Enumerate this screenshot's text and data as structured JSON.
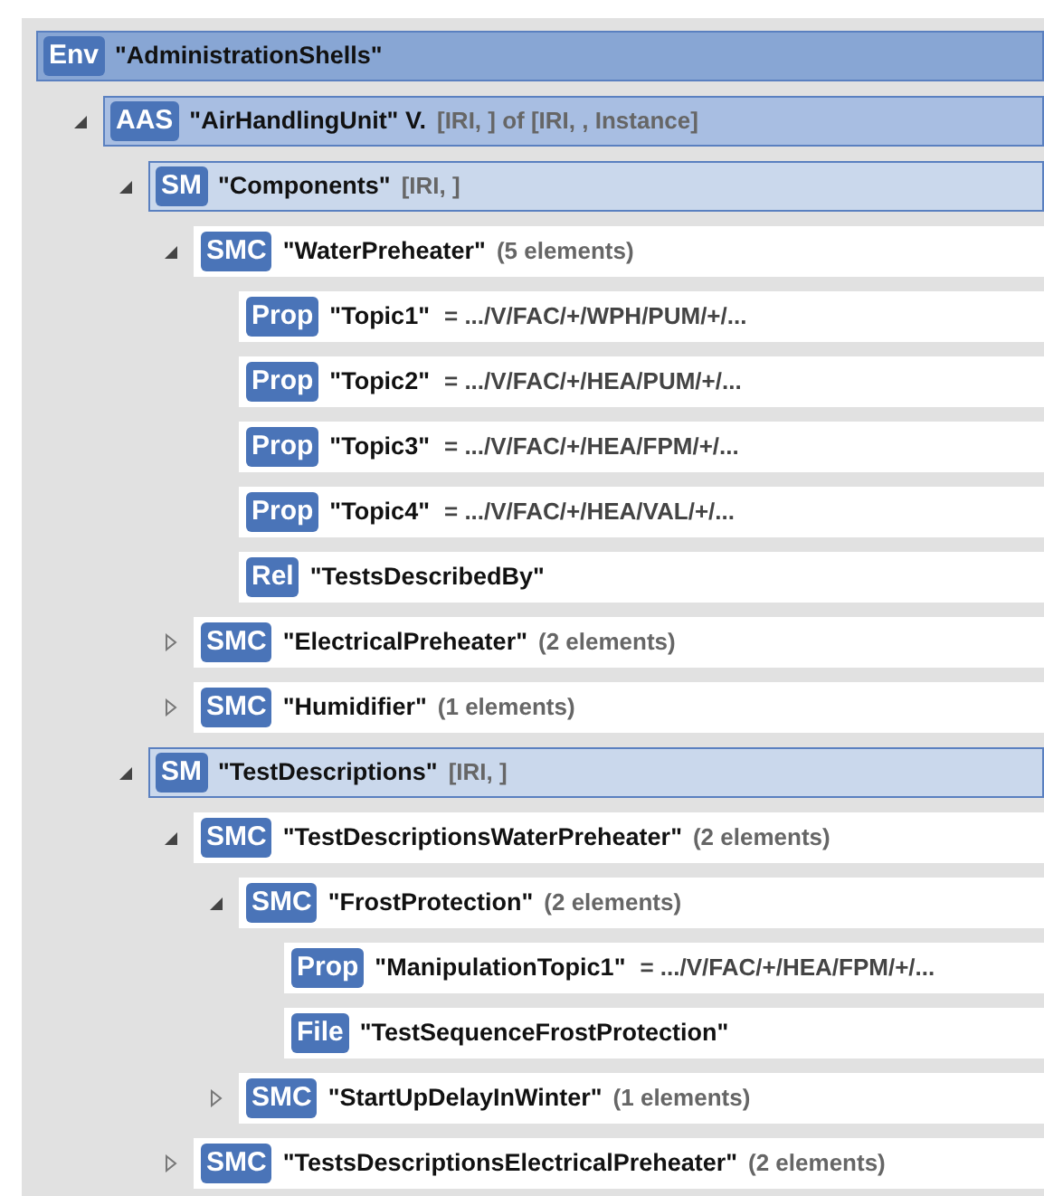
{
  "tree": [
    {
      "kind": "env",
      "tag": "Env",
      "name": "\"AdministrationShells\"",
      "children": [
        {
          "kind": "aas",
          "tag": "AAS",
          "name": "\"AirHandlingUnit\" V.",
          "info": "[IRI, ] of [IRI, , Instance]",
          "expanded": true,
          "children": [
            {
              "kind": "sm",
              "tag": "SM",
              "name": "\"Components\"",
              "info": "[IRI, ]",
              "expanded": true,
              "children": [
                {
                  "kind": "item",
                  "tag": "SMC",
                  "name": "\"WaterPreheater\"",
                  "info": "(5 elements)",
                  "expanded": true,
                  "children": [
                    {
                      "kind": "item",
                      "tag": "Prop",
                      "name": "\"Topic1\"",
                      "value": "= .../V/FAC/+/WPH/PUM/+/..."
                    },
                    {
                      "kind": "item",
                      "tag": "Prop",
                      "name": "\"Topic2\"",
                      "value": "= .../V/FAC/+/HEA/PUM/+/..."
                    },
                    {
                      "kind": "item",
                      "tag": "Prop",
                      "name": "\"Topic3\"",
                      "value": "= .../V/FAC/+/HEA/FPM/+/..."
                    },
                    {
                      "kind": "item",
                      "tag": "Prop",
                      "name": "\"Topic4\"",
                      "value": "= .../V/FAC/+/HEA/VAL/+/..."
                    },
                    {
                      "kind": "item",
                      "tag": "Rel",
                      "name": "\"TestsDescribedBy\""
                    }
                  ]
                },
                {
                  "kind": "item",
                  "tag": "SMC",
                  "name": "\"ElectricalPreheater\"",
                  "info": "(2 elements)",
                  "expanded": false
                },
                {
                  "kind": "item",
                  "tag": "SMC",
                  "name": "\"Humidifier\"",
                  "info": "(1 elements)",
                  "expanded": false
                }
              ]
            },
            {
              "kind": "sm",
              "tag": "SM",
              "name": "\"TestDescriptions\"",
              "info": "[IRI,  ]",
              "expanded": true,
              "children": [
                {
                  "kind": "item",
                  "tag": "SMC",
                  "name": "\"TestDescriptionsWaterPreheater\"",
                  "info": "(2 elements)",
                  "expanded": true,
                  "children": [
                    {
                      "kind": "item",
                      "tag": "SMC",
                      "name": "\"FrostProtection\"",
                      "info": "(2 elements)",
                      "expanded": true,
                      "children": [
                        {
                          "kind": "item",
                          "tag": "Prop",
                          "name": "\"ManipulationTopic1\"",
                          "value": "= .../V/FAC/+/HEA/FPM/+/..."
                        },
                        {
                          "kind": "item",
                          "tag": "File",
                          "name": "\"TestSequenceFrostProtection\""
                        }
                      ]
                    },
                    {
                      "kind": "item",
                      "tag": "SMC",
                      "name": "\"StartUpDelayInWinter\"",
                      "info": "(1 elements)",
                      "expanded": false
                    }
                  ]
                },
                {
                  "kind": "item",
                  "tag": "SMC",
                  "name": "\"TestsDescriptionsElectricalPreheater\"",
                  "info": "(2 elements)",
                  "expanded": false
                }
              ]
            }
          ]
        }
      ]
    }
  ]
}
